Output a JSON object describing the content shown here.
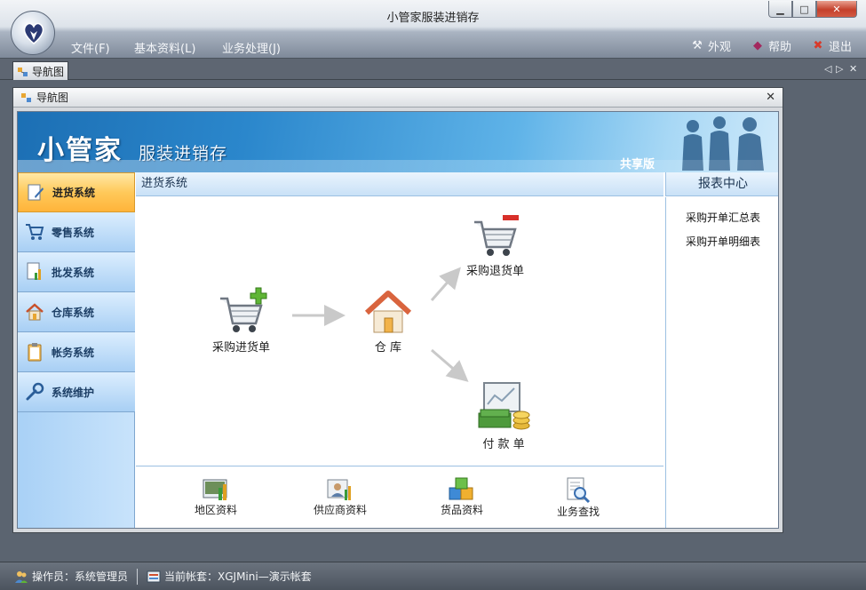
{
  "window": {
    "title": "小管家服装进销存"
  },
  "menu": {
    "file": "文件(F)",
    "basic": "基本资料(L)",
    "biz": "业务处理(J)",
    "skin": "外观",
    "help": "帮助",
    "exit": "退出"
  },
  "tab": {
    "label": "导航图"
  },
  "child": {
    "title": "导航图"
  },
  "banner": {
    "brand": "小管家",
    "subtitle": "服装进销存",
    "edition": "共享版"
  },
  "sidebar": {
    "items": [
      {
        "label": "进货系统",
        "icon": "document-pencil-icon",
        "active": true
      },
      {
        "label": "零售系统",
        "icon": "cart-icon",
        "active": false
      },
      {
        "label": "批发系统",
        "icon": "document-chart-icon",
        "active": false
      },
      {
        "label": "仓库系统",
        "icon": "house-icon",
        "active": false
      },
      {
        "label": "帐务系统",
        "icon": "clipboard-icon",
        "active": false
      },
      {
        "label": "系统维护",
        "icon": "wrench-icon",
        "active": false
      }
    ]
  },
  "main": {
    "header": "进货系统",
    "nodes": {
      "purchase": "采购进货单",
      "warehouse": "仓  库",
      "return": "采购退货单",
      "payment": "付 款 单"
    },
    "quick_links": [
      {
        "label": "地区资料",
        "icon": "map-chart-icon"
      },
      {
        "label": "供应商资料",
        "icon": "supplier-icon"
      },
      {
        "label": "货品资料",
        "icon": "boxes-icon"
      },
      {
        "label": "业务查找",
        "icon": "search-document-icon"
      }
    ]
  },
  "report": {
    "header": "报表中心",
    "links": [
      "采购开单汇总表",
      "采购开单明细表"
    ]
  },
  "status": {
    "operator": "操作员：系统管理员",
    "account": "当前帐套：XGJMini—演示帐套"
  },
  "colors": {
    "accent": "#2b87cc",
    "active_tab": "#ffc95a",
    "sidebar": "#a9d1f6"
  }
}
